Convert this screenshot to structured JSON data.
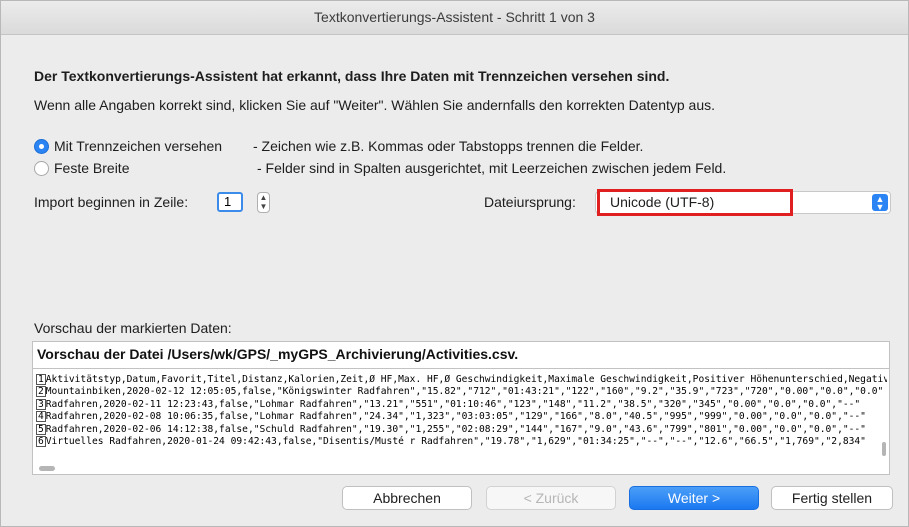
{
  "window": {
    "title": "Textkonvertierungs-Assistent - Schritt 1 von 3"
  },
  "intro": {
    "heading": "Der Textkonvertierungs-Assistent hat erkannt, dass Ihre Daten mit Trennzeichen versehen sind.",
    "instruction": "Wenn alle Angaben korrekt sind, klicken Sie auf \"Weiter\". Wählen Sie andernfalls den korrekten Datentyp aus."
  },
  "options": {
    "delimited": {
      "label": "Mit Trennzeichen versehen",
      "description": "- Zeichen wie z.B. Kommas oder Tabstopps trennen die Felder.",
      "selected": true
    },
    "fixed": {
      "label": "Feste Breite",
      "description": "- Felder sind in Spalten ausgerichtet, mit Leerzeichen zwischen jedem Feld.",
      "selected": false
    }
  },
  "start_row": {
    "label": "Import beginnen in Zeile:",
    "value": "1"
  },
  "file_origin": {
    "label": "Dateiursprung:",
    "value": "Unicode (UTF-8)"
  },
  "preview": {
    "label": "Vorschau der markierten Daten:",
    "file_title": "Vorschau der Datei /Users/wk/GPS/_myGPS_Archivierung/Activities.csv.",
    "rows": [
      {
        "num": "1",
        "text": "Aktivitätstyp,Datum,Favorit,Titel,Distanz,Kalorien,Zeit,Ø  HF,Max. HF,Ø  Geschwindigkeit,Maximale Geschwindigkeit,Positiver Höhenunterschied,Negativ"
      },
      {
        "num": "2",
        "text": "Mountainbiken,2020-02-12 12:05:05,false,\"Königswinter Radfahren\",\"15.82\",\"712\",\"01:43:21\",\"122\",\"160\",\"9.2\",\"35.9\",\"723\",\"720\",\"0.00\",\"0.0\",\"0.0\""
      },
      {
        "num": "3",
        "text": "Radfahren,2020-02-11 12:23:43,false,\"Lohmar Radfahren\",\"13.21\",\"551\",\"01:10:46\",\"123\",\"148\",\"11.2\",\"38.5\",\"320\",\"345\",\"0.00\",\"0.0\",\"0.0\",\"--\""
      },
      {
        "num": "4",
        "text": "Radfahren,2020-02-08 10:06:35,false,\"Lohmar Radfahren\",\"24.34\",\"1,323\",\"03:03:05\",\"129\",\"166\",\"8.0\",\"40.5\",\"995\",\"999\",\"0.00\",\"0.0\",\"0.0\",\"--\""
      },
      {
        "num": "5",
        "text": "Radfahren,2020-02-06 14:12:38,false,\"Schuld Radfahren\",\"19.30\",\"1,255\",\"02:08:29\",\"144\",\"167\",\"9.0\",\"43.6\",\"799\",\"801\",\"0.00\",\"0.0\",\"0.0\",\"--\""
      },
      {
        "num": "6",
        "text": "Virtuelles Radfahren,2020-01-24 09:42:43,false,\"Disentis/Musté r Radfahren\",\"19.78\",\"1,629\",\"01:34:25\",\"--\",\"--\",\"12.6\",\"66.5\",\"1,769\",\"2,834\""
      }
    ]
  },
  "buttons": {
    "cancel": "Abbrechen",
    "back": "< Zurück",
    "next": "Weiter >",
    "finish": "Fertig stellen"
  },
  "colors": {
    "accent": "#2a84f3",
    "highlight_box": "#e02020"
  }
}
